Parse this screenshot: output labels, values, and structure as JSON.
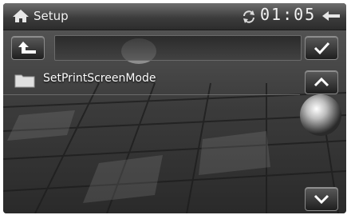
{
  "header": {
    "title": "Setup",
    "clock": "01:05"
  },
  "file_list": {
    "items": [
      {
        "label": "SetPrintScreenMode",
        "icon": "folder-icon"
      }
    ]
  },
  "icons": {
    "home": "home-icon",
    "sync": "sync-icon",
    "back": "back-arrow-icon",
    "up_folder": "up-level-arrow-icon",
    "confirm": "checkmark-icon",
    "scroll_up": "chevron-up-icon",
    "scroll_down": "chevron-down-icon"
  },
  "colors": {
    "text": "#ffffff",
    "header_bg": "#3c3c3c"
  }
}
